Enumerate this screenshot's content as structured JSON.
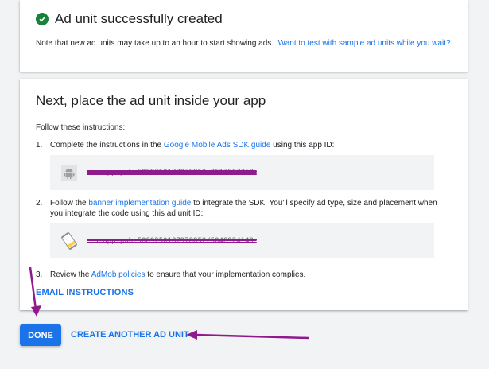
{
  "success_card": {
    "title": "Ad unit successfully created",
    "note": "Note that new ad units may take up to an hour to start showing ads.",
    "sample_link": "Want to test with sample ad units while you wait?",
    "icon": "check-circle-icon"
  },
  "instructions_card": {
    "title": "Next, place the ad unit inside your app",
    "follow": "Follow these instructions:",
    "steps": [
      {
        "num": "1.",
        "pre": "Complete the instructions in the ",
        "link": "Google Mobile Ads SDK guide",
        "post": " using this app ID:",
        "code": "ca-app-pub-5089250187978852~3617807758",
        "icon": "android-icon"
      },
      {
        "num": "2.",
        "pre": "Follow the ",
        "link": "banner implementation guide",
        "post": " to integrate the SDK. You'll specify ad type, size and placement when you integrate the code using this ad unit ID:",
        "code": "ca-app-pub-5089250187978852/5048924149",
        "icon": "banner-ad-icon"
      },
      {
        "num": "3.",
        "pre": "Review the ",
        "link": "AdMob policies",
        "post": " to ensure that your implementation complies."
      }
    ],
    "email_button": "EMAIL INSTRUCTIONS"
  },
  "actions": {
    "done": "DONE",
    "create_another": "CREATE ANOTHER AD UNIT"
  },
  "colors": {
    "accent": "#1a73e8",
    "success": "#188038",
    "annotation": "#8e1a8e"
  }
}
